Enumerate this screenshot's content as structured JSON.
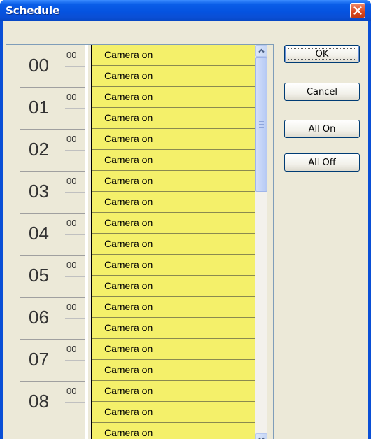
{
  "window": {
    "title": "Schedule"
  },
  "buttons": {
    "ok": "OK",
    "cancel": "Cancel",
    "all_on": "All On",
    "all_off": "All Off"
  },
  "hours": [
    {
      "hour": "00",
      "minute": "00"
    },
    {
      "hour": "01",
      "minute": "00"
    },
    {
      "hour": "02",
      "minute": "00"
    },
    {
      "hour": "03",
      "minute": "00"
    },
    {
      "hour": "04",
      "minute": "00"
    },
    {
      "hour": "05",
      "minute": "00"
    },
    {
      "hour": "06",
      "minute": "00"
    },
    {
      "hour": "07",
      "minute": "00"
    },
    {
      "hour": "08",
      "minute": "00"
    }
  ],
  "slots": [
    "Camera on",
    "Camera on",
    "Camera on",
    "Camera on",
    "Camera on",
    "Camera on",
    "Camera on",
    "Camera on",
    "Camera on",
    "Camera on",
    "Camera on",
    "Camera on",
    "Camera on",
    "Camera on",
    "Camera on",
    "Camera on",
    "Camera on",
    "Camera on",
    "Camera on"
  ],
  "colors": {
    "slot_on": "#f4f06a",
    "title_bar": "#0a4fd6",
    "dialog_bg": "#ece9d8"
  },
  "icons": {
    "close": "close-icon",
    "scroll_up": "arrow-up-icon",
    "scroll_down": "arrow-down-icon"
  }
}
